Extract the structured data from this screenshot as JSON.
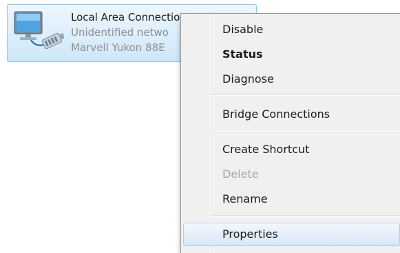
{
  "connection": {
    "name": "Local Area Connection",
    "status": "Unidentified netwo",
    "device": "Marvell Yukon 88E",
    "icon": "network-adapter-icon"
  },
  "menu": {
    "items": [
      {
        "label": "Disable"
      },
      {
        "label": "Status"
      },
      {
        "label": "Diagnose"
      },
      {
        "label": "Bridge Connections"
      },
      {
        "label": "Create Shortcut"
      },
      {
        "label": "Delete"
      },
      {
        "label": "Rename"
      },
      {
        "label": "Properties"
      }
    ]
  },
  "colors": {
    "tile_border": "#8ec5ea",
    "tile_bg": "#dbeefc",
    "menu_bg": "#f0f0f0",
    "hover_border": "#aecdf0",
    "disabled_text": "#a5a5a5"
  }
}
